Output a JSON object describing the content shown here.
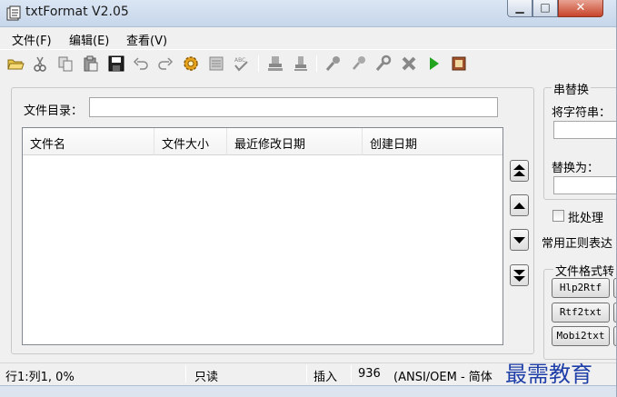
{
  "window": {
    "title": "txtFormat V2.05"
  },
  "menu": {
    "items": [
      "文件(F)",
      "编辑(E)",
      "查看(V)"
    ]
  },
  "toolbar": {
    "icons": [
      "open-folder-icon",
      "cut-icon",
      "copy-icon",
      "paste-icon",
      "save-icon",
      "undo-icon",
      "redo-icon",
      "settings-gear-icon",
      "format-icon",
      "spellcheck-icon",
      "stamp-icon",
      "stamp2-icon",
      "key-icon",
      "key2-icon",
      "wrench-icon",
      "clear-icon",
      "run-icon",
      "book-icon"
    ]
  },
  "main": {
    "dir_label": "文件目录：",
    "dir_value": "",
    "columns": [
      "文件名",
      "文件大小",
      "最近修改日期",
      "创建日期"
    ],
    "rows": []
  },
  "replace": {
    "title": "串替换",
    "find_label": "将字符串：",
    "find_value": "",
    "replace_label": "替换为：",
    "replace_value": ""
  },
  "batch": {
    "label": "批处理",
    "checked": false
  },
  "regex": {
    "label": "常用正则表达"
  },
  "convert": {
    "title": "文件格式转",
    "buttons": [
      "Hlp2Rtf",
      "Rtf2txt",
      "Mobi2txt"
    ]
  },
  "status": {
    "position": "行1:列1, 0%",
    "readonly": "只读",
    "mode": "插入",
    "codepage": "936",
    "encoding": "(ANSI/OEM - 简体"
  },
  "watermark": "最需教育",
  "colors": {
    "close_button": "#c7442b",
    "run_icon": "#23a41f",
    "watermark": "#1f3fa8"
  }
}
